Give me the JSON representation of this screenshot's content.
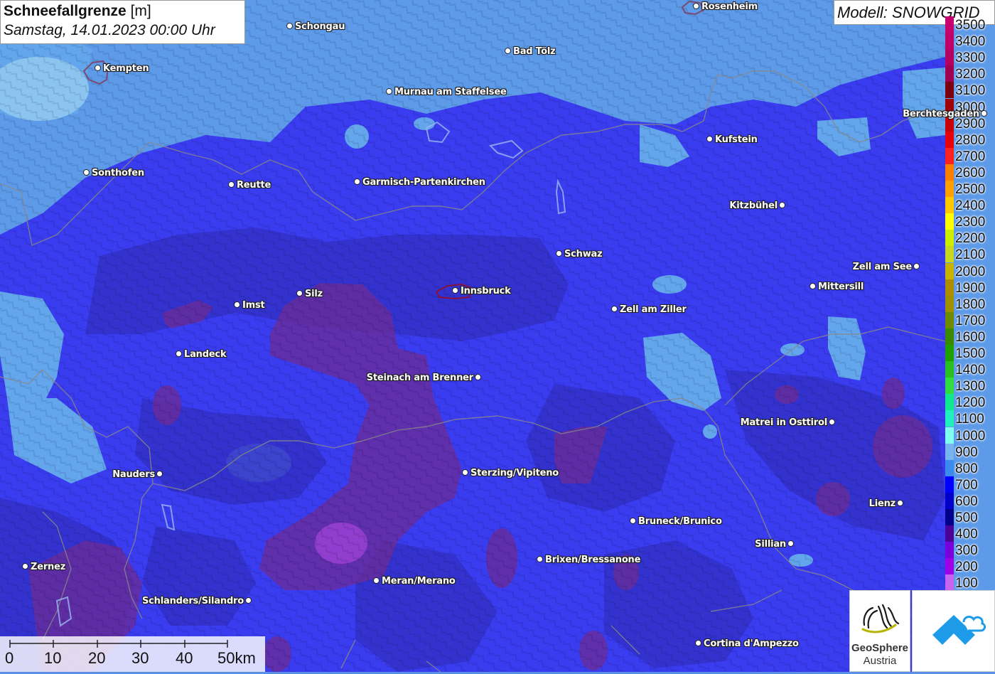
{
  "header": {
    "title": "Schneefallgrenze",
    "unit": "[m]",
    "datetime": "Samstag, 14.01.2023 00:00 Uhr",
    "model": "Modell: SNOWGRID"
  },
  "legend": [
    {
      "label": "3500",
      "color": "#c8006e"
    },
    {
      "label": "3400",
      "color": "#c00068"
    },
    {
      "label": "3300",
      "color": "#b40060"
    },
    {
      "label": "3200",
      "color": "#a00050"
    },
    {
      "label": "3100",
      "color": "#7a0010"
    },
    {
      "label": "3000",
      "color": "#a00008"
    },
    {
      "label": "2900",
      "color": "#c80008"
    },
    {
      "label": "2800",
      "color": "#e6000a"
    },
    {
      "label": "2700",
      "color": "#ff2020"
    },
    {
      "label": "2600",
      "color": "#ff8000"
    },
    {
      "label": "2500",
      "color": "#ffa000"
    },
    {
      "label": "2400",
      "color": "#ffc800"
    },
    {
      "label": "2300",
      "color": "#ffff00"
    },
    {
      "label": "2200",
      "color": "#ccee00"
    },
    {
      "label": "2100",
      "color": "#c8d820"
    },
    {
      "label": "2000",
      "color": "#c8b400"
    },
    {
      "label": "1900",
      "color": "#b08c00"
    },
    {
      "label": "1800",
      "color": "#a09000"
    },
    {
      "label": "1700",
      "color": "#6e8a00"
    },
    {
      "label": "1600",
      "color": "#3a8a00"
    },
    {
      "label": "1500",
      "color": "#20a000"
    },
    {
      "label": "1400",
      "color": "#28c020"
    },
    {
      "label": "1300",
      "color": "#30dc40"
    },
    {
      "label": "1200",
      "color": "#10e890"
    },
    {
      "label": "1100",
      "color": "#20f0c0"
    },
    {
      "label": "1000",
      "color": "#80fff0"
    },
    {
      "label": "900",
      "color": "#78b4f0"
    },
    {
      "label": "800",
      "color": "#3c8cf0"
    },
    {
      "label": "700",
      "color": "#0000ff"
    },
    {
      "label": "600",
      "color": "#0000c8"
    },
    {
      "label": "500",
      "color": "#00008c"
    },
    {
      "label": "400",
      "color": "#4b0096"
    },
    {
      "label": "300",
      "color": "#7800dc"
    },
    {
      "label": "200",
      "color": "#a000e6"
    },
    {
      "label": "100",
      "color": "#c864f0"
    }
  ],
  "cities": [
    {
      "name": "Rosenheim",
      "side": "right"
    },
    {
      "name": "Schongau",
      "side": "right"
    },
    {
      "name": "Kempten",
      "side": "right"
    },
    {
      "name": "Bad Tölz",
      "side": "right"
    },
    {
      "name": "Murnau am Staffelsee",
      "side": "right"
    },
    {
      "name": "Berchtesgaden",
      "side": "left"
    },
    {
      "name": "Kufstein",
      "side": "right"
    },
    {
      "name": "Sonthofen",
      "side": "right"
    },
    {
      "name": "Reutte",
      "side": "right"
    },
    {
      "name": "Garmisch-Partenkirchen",
      "side": "right"
    },
    {
      "name": "Kitzbühel",
      "side": "left"
    },
    {
      "name": "Schwaz",
      "side": "right"
    },
    {
      "name": "Zell am See",
      "side": "left"
    },
    {
      "name": "Innsbruck",
      "side": "right"
    },
    {
      "name": "Mittersill",
      "side": "right"
    },
    {
      "name": "Imst",
      "side": "right"
    },
    {
      "name": "Silz",
      "side": "right"
    },
    {
      "name": "Zell am Ziller",
      "side": "right"
    },
    {
      "name": "Landeck",
      "side": "right"
    },
    {
      "name": "Steinach am Brenner",
      "side": "left"
    },
    {
      "name": "Matrei in Osttirol",
      "side": "left"
    },
    {
      "name": "Nauders",
      "side": "left"
    },
    {
      "name": "Sterzing/Vipiteno",
      "side": "right"
    },
    {
      "name": "Lienz",
      "side": "left"
    },
    {
      "name": "Bruneck/Brunico",
      "side": "right"
    },
    {
      "name": "Sillian",
      "side": "left"
    },
    {
      "name": "Brixen/Bressanone",
      "side": "right"
    },
    {
      "name": "Zernez",
      "side": "right"
    },
    {
      "name": "Meran/Merano",
      "side": "right"
    },
    {
      "name": "Schlanders/Silandro",
      "side": "left"
    },
    {
      "name": "Cortina d'Ampezzo",
      "side": "right"
    }
  ],
  "scale": {
    "ticks": [
      "0",
      "10",
      "20",
      "30",
      "40",
      "50km"
    ]
  },
  "logos": {
    "geosphere_line1": "GeoSphere",
    "geosphere_line2": "Austria"
  }
}
